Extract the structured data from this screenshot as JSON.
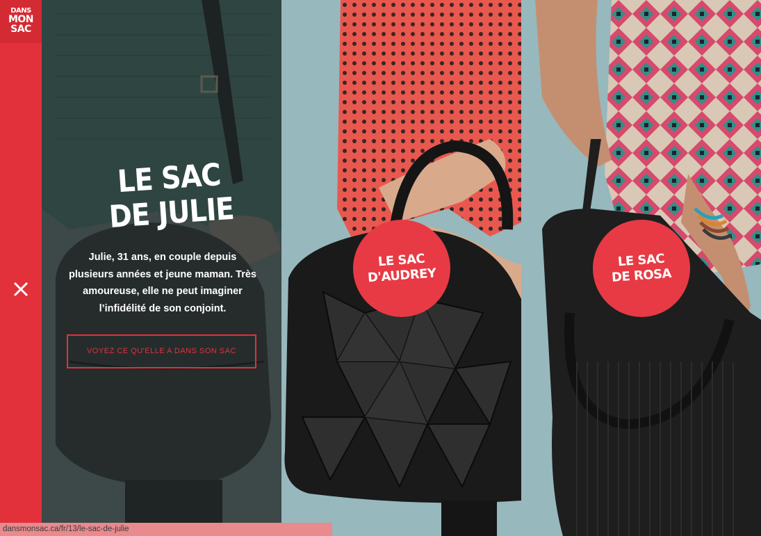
{
  "logo": {
    "line1": "DANS",
    "line2": "MON",
    "line3": "SAC"
  },
  "julie": {
    "title_line1": "LE SAC",
    "title_line2": "DE JULIE",
    "description": "Julie, 31 ans, en couple depuis plusieurs années et jeune maman. Très amoureuse, elle ne peut imaginer l’infidélité de son conjoint.",
    "cta_label": "VOYEZ CE QU'ELLE A DANS SON SAC"
  },
  "audrey": {
    "line1": "LE SAC",
    "line2": "D'AUDREY"
  },
  "rosa": {
    "line1": "LE SAC",
    "line2": "DE ROSA"
  },
  "status_url": "dansmonsac.ca/fr/13/le-sac-de-julie",
  "colors": {
    "brand_red": "#e3313b",
    "teal_bg": "#97b8bc",
    "dark_overlay": "#3f4a4a"
  }
}
